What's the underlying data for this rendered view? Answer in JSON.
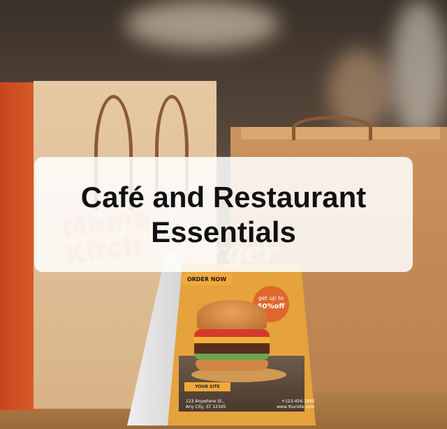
{
  "banner": {
    "title_line1": "Café and Restaurant",
    "title_line2": "Essentials"
  },
  "tent_card": {
    "order_label": "ORDER NOW",
    "offer_line1": "get up to",
    "offer_line2": "50%off",
    "site_label": "YOUR SITE",
    "address_line1": "123 Anywhere St.,",
    "address_line2": "Any City, ST 12345",
    "phone": "+123-456-7890",
    "website": "www.Yoursite.com"
  },
  "colors": {
    "accent_orange": "#f2a93b",
    "bag_red": "#c8451c",
    "kraft": "#d8b387"
  }
}
